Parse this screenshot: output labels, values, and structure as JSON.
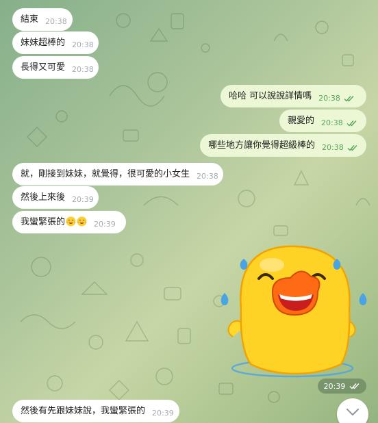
{
  "messages": [
    {
      "text": "結束",
      "time": "20:38"
    },
    {
      "text": "妹妹超棒的",
      "time": "20:38"
    },
    {
      "text": "長得又可愛",
      "time": "20:38"
    },
    {
      "text": "哈哈  可以說說詳情嗎",
      "time": "20:38",
      "read": true
    },
    {
      "text": "親愛的",
      "time": "20:38",
      "read": true
    },
    {
      "text": "哪些地方讓你覺得超級棒的",
      "time": "20:38",
      "read": true
    },
    {
      "text": "就，剛接到妹妹，就覺得，很可愛的小女生",
      "time": "20:38"
    },
    {
      "text": "然後上來後",
      "time": "20:39"
    },
    {
      "text": "我蠻緊張的",
      "emoji": [
        "face-with-tears-of-joy",
        "face-with-tears-of-joy"
      ],
      "time": "20:39"
    },
    {
      "text": "然後有先跟妹妹說，我蠻緊張的",
      "time": "20:39"
    }
  ],
  "sticker": {
    "name": "laughing-yellow-duck-sticker",
    "time": "20:39",
    "read": true
  },
  "icons": {
    "read_receipt": "double-check-icon",
    "scroll": "chevron-down-icon"
  },
  "colors": {
    "incoming_bubble": "#ffffff",
    "outgoing_bubble": "#ebf7d5",
    "outgoing_time": "#58a65a",
    "incoming_time": "#a4abb1",
    "wallpaper": "#a9c39a"
  }
}
